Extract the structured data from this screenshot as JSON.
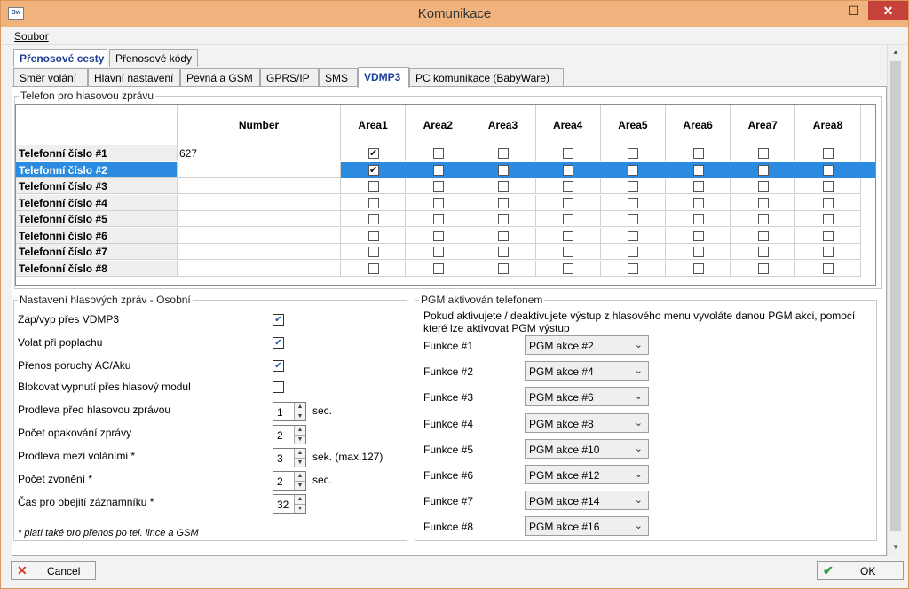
{
  "window": {
    "title": "Komunikace",
    "icon": "app-logo-icon",
    "min": "—",
    "max": "☐",
    "close": "✕"
  },
  "menu": {
    "file": "Soubor"
  },
  "tabs_top": [
    "Přenosové cesty",
    "Přenosové kódy"
  ],
  "tabs_sub": [
    "Směr volání",
    "Hlavní nastavení",
    "Pevná a GSM",
    "GPRS/IP",
    "SMS",
    "VDMP3",
    "PC komunikace (BabyWare)"
  ],
  "phone_group": {
    "title": "Telefon pro hlasovou zprávu",
    "columns": [
      "Number",
      "Area1",
      "Area2",
      "Area3",
      "Area4",
      "Area5",
      "Area6",
      "Area7",
      "Area8"
    ],
    "rows": [
      {
        "label": "Telefonní číslo #1",
        "number": "627",
        "areas": [
          true,
          false,
          false,
          false,
          false,
          false,
          false,
          false
        ]
      },
      {
        "label": "Telefonní číslo #2",
        "number": "",
        "areas": [
          true,
          false,
          false,
          false,
          false,
          false,
          false,
          false
        ]
      },
      {
        "label": "Telefonní číslo #3",
        "number": "",
        "areas": [
          false,
          false,
          false,
          false,
          false,
          false,
          false,
          false
        ]
      },
      {
        "label": "Telefonní číslo #4",
        "number": "",
        "areas": [
          false,
          false,
          false,
          false,
          false,
          false,
          false,
          false
        ]
      },
      {
        "label": "Telefonní číslo #5",
        "number": "",
        "areas": [
          false,
          false,
          false,
          false,
          false,
          false,
          false,
          false
        ]
      },
      {
        "label": "Telefonní číslo #6",
        "number": "",
        "areas": [
          false,
          false,
          false,
          false,
          false,
          false,
          false,
          false
        ]
      },
      {
        "label": "Telefonní číslo #7",
        "number": "",
        "areas": [
          false,
          false,
          false,
          false,
          false,
          false,
          false,
          false
        ]
      },
      {
        "label": "Telefonní číslo #8",
        "number": "",
        "areas": [
          false,
          false,
          false,
          false,
          false,
          false,
          false,
          false
        ]
      }
    ]
  },
  "voice": {
    "title": "Nastavení hlasových zpráv - Osobní",
    "checks": [
      {
        "label": "Zap/vyp přes VDMP3",
        "checked": true
      },
      {
        "label": "Volat při poplachu",
        "checked": true
      },
      {
        "label": "Přenos poruchy AC/Aku",
        "checked": true
      },
      {
        "label": "Blokovat vypnutí přes hlasový modul",
        "checked": false
      }
    ],
    "spins": [
      {
        "label": "Prodleva před hlasovou zprávou",
        "value": "1",
        "unit": "sec."
      },
      {
        "label": "Počet opakování zprávy",
        "value": "2",
        "unit": ""
      },
      {
        "label": "Prodleva mezi voláními *",
        "value": "3",
        "unit": "sek. (max.127)"
      },
      {
        "label": "Počet zvonění *",
        "value": "2",
        "unit": "sec."
      },
      {
        "label": "Čas pro obejití záznamníku *",
        "value": "32",
        "unit": ""
      }
    ],
    "note": "* platí také pro přenos po tel. lince a GSM"
  },
  "pgm": {
    "title": "PGM aktivován telefonem",
    "desc1": "Pokud aktivujete / deaktivujete výstup z hlasového menu vyvoláte danou PGM akci, pomocí",
    "desc2": "které lze aktivovat PGM výstup",
    "items": [
      {
        "label": "Funkce #1",
        "value": "PGM akce #2"
      },
      {
        "label": "Funkce #2",
        "value": "PGM akce #4"
      },
      {
        "label": "Funkce #3",
        "value": "PGM akce #6"
      },
      {
        "label": "Funkce #4",
        "value": "PGM akce #8"
      },
      {
        "label": "Funkce #5",
        "value": "PGM akce #10"
      },
      {
        "label": "Funkce #6",
        "value": "PGM akce #12"
      },
      {
        "label": "Funkce #7",
        "value": "PGM akce #14"
      },
      {
        "label": "Funkce #8",
        "value": "PGM akce #16"
      }
    ]
  },
  "buttons": {
    "cancel": "Cancel",
    "ok": "OK"
  },
  "colors": {
    "titlebar": "#f0b37e",
    "selection": "#2a8be0",
    "tab_active_text": "#1c3f94"
  }
}
